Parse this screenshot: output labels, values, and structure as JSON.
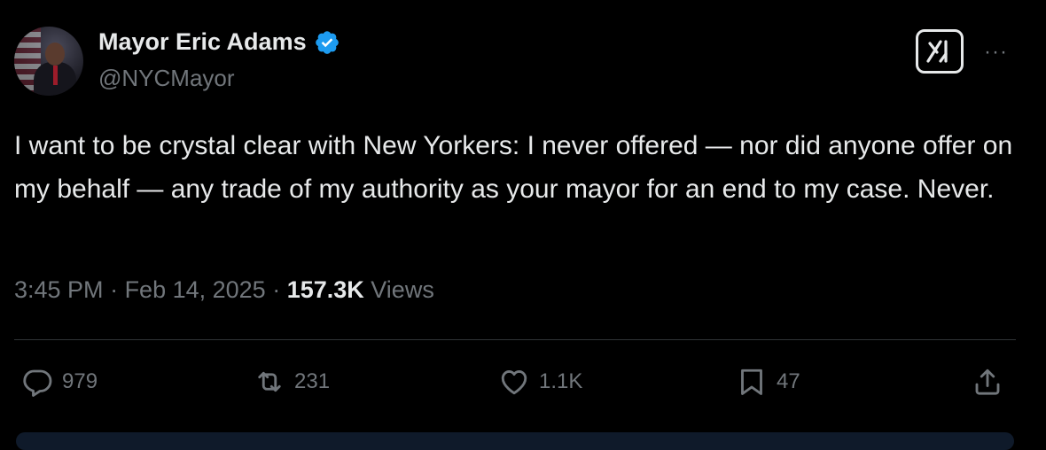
{
  "author": {
    "name": "Mayor Eric Adams",
    "handle": "@NYCMayor",
    "verified_color": "#1d9bf0"
  },
  "header": {
    "grok_icon": "grok-icon",
    "more_label": "···"
  },
  "tweet": {
    "text": "I want to be crystal clear with New Yorkers: I never offered — nor did anyone offer on my behalf — any trade of my authority as your mayor for an end to my case. Never."
  },
  "meta": {
    "time": "3:45 PM",
    "sep1": " · ",
    "date": "Feb 14, 2025",
    "sep2": " · ",
    "views_count": "157.3K",
    "views_label": " Views"
  },
  "actions": {
    "replies": "979",
    "reposts": "231",
    "likes": "1.1K",
    "bookmarks": "47"
  }
}
